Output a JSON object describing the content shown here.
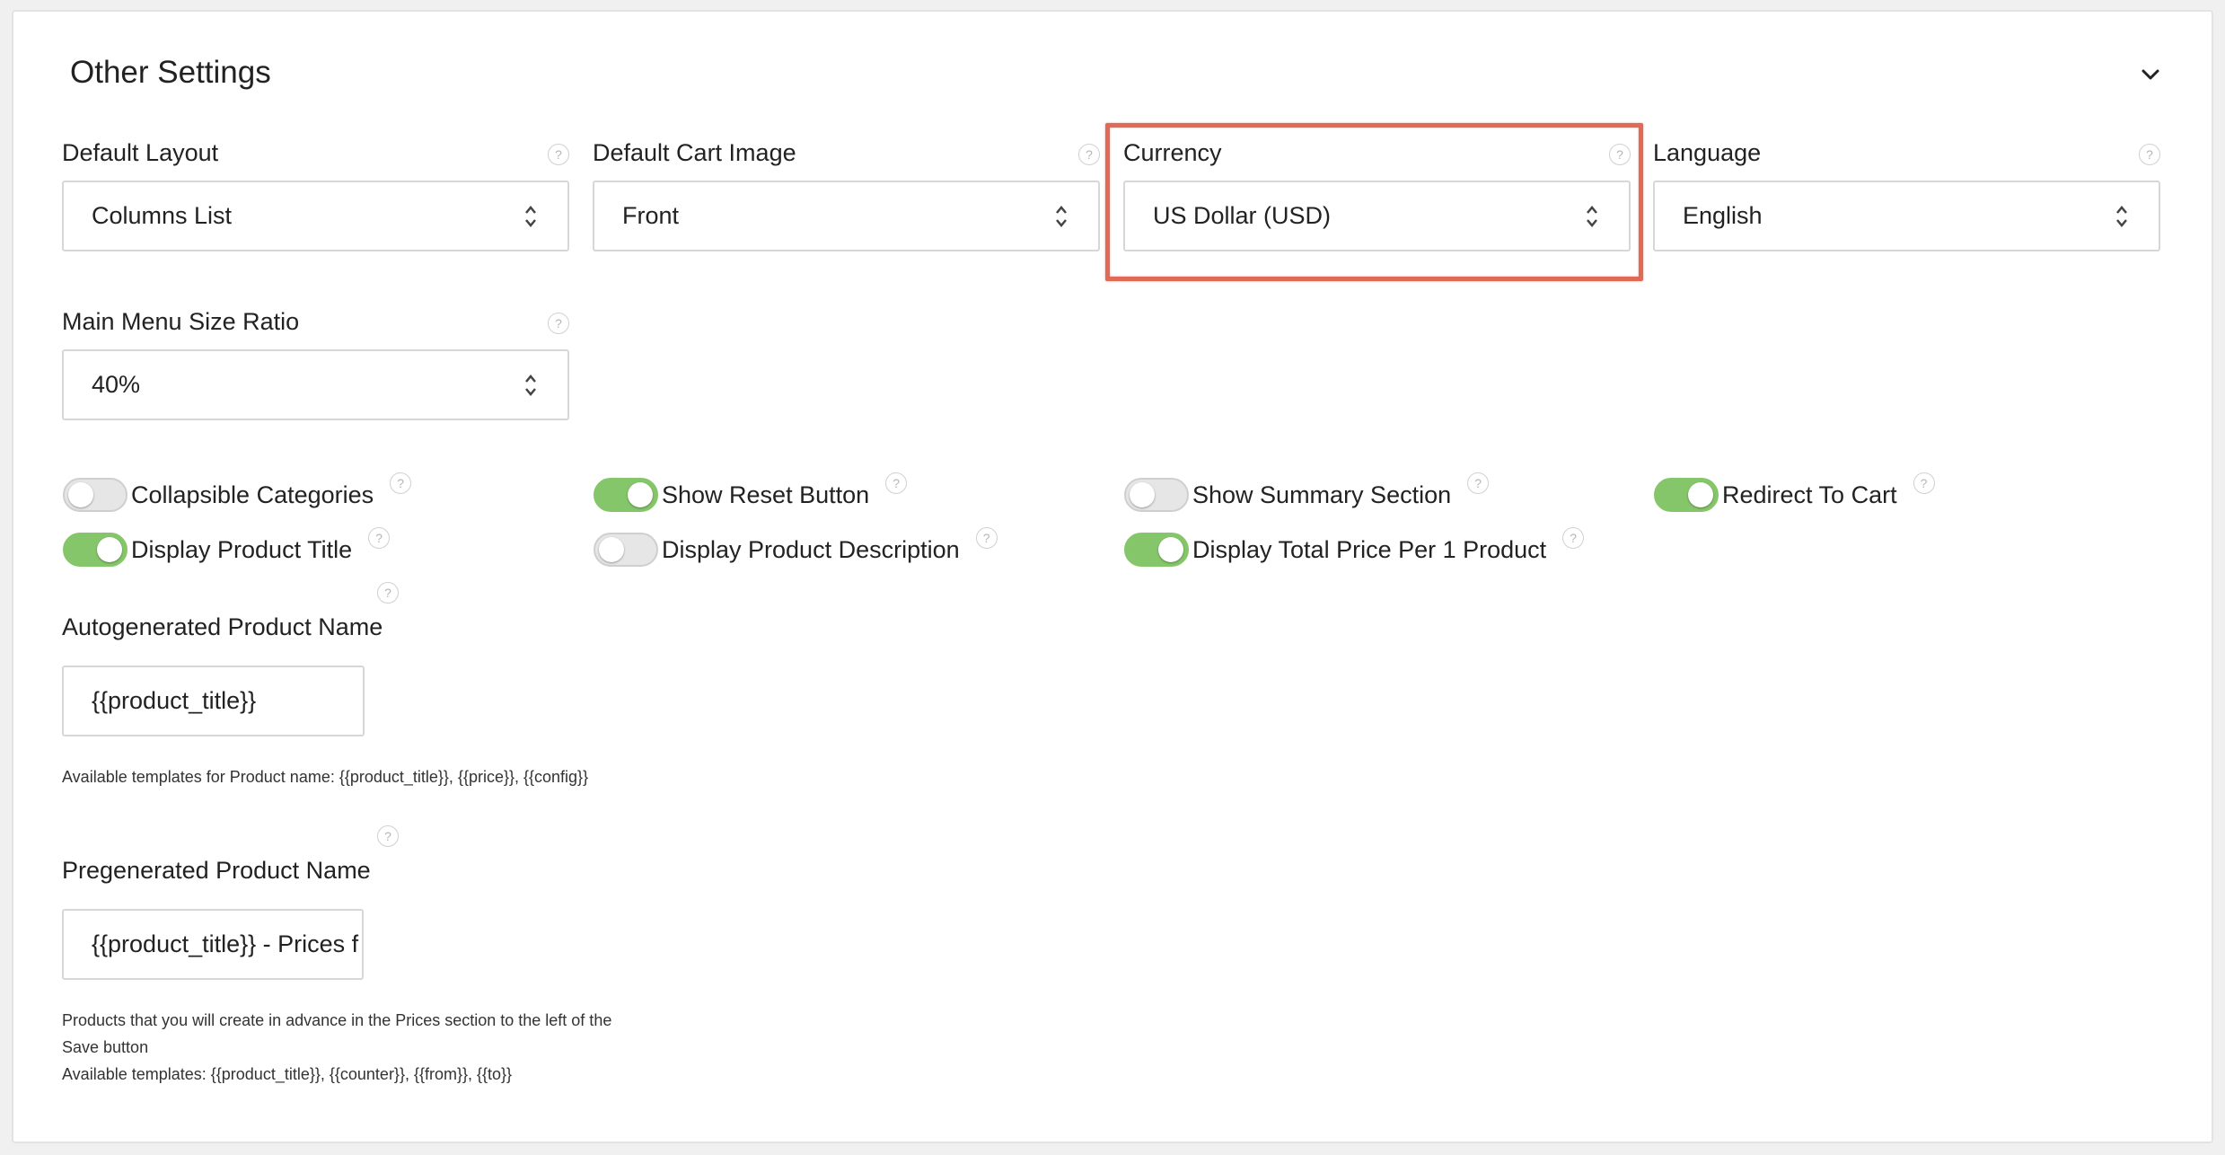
{
  "panel": {
    "title": "Other Settings",
    "collapse_icon": "chevron-down-icon"
  },
  "selects": {
    "default_layout": {
      "label": "Default Layout",
      "value": "Columns List"
    },
    "default_cart_image": {
      "label": "Default Cart Image",
      "value": "Front"
    },
    "currency": {
      "label": "Currency",
      "value": "US Dollar (USD)"
    },
    "language": {
      "label": "Language",
      "value": "English"
    },
    "main_menu_size_ratio": {
      "label": "Main Menu Size Ratio",
      "value": "40%"
    }
  },
  "help_glyph": "?",
  "toggles": {
    "collapsible_categories": {
      "label": "Collapsible Categories",
      "on": false
    },
    "show_reset_button": {
      "label": "Show Reset Button",
      "on": true
    },
    "show_summary_section": {
      "label": "Show Summary Section",
      "on": false
    },
    "redirect_to_cart": {
      "label": "Redirect To Cart",
      "on": true
    },
    "display_product_title": {
      "label": "Display Product Title",
      "on": true
    },
    "display_product_description": {
      "label": "Display Product Description",
      "on": false
    },
    "display_total_price": {
      "label": "Display Total Price Per 1 Product",
      "on": true
    }
  },
  "autogenerated": {
    "label": "Autogenerated Product Name",
    "value": "{{product_title}}",
    "hint": "Available templates for Product name: {{product_title}}, {{price}}, {{config}}"
  },
  "pregenerated": {
    "label": "Pregenerated Product Name",
    "value": "{{product_title}} - Prices f",
    "hint_line1": "Products that you will create in advance in the Prices section to the left of the",
    "hint_line2": "Save button",
    "hint_line3": "Available templates: {{product_title}}, {{counter}}, {{from}}, {{to}}"
  },
  "colors": {
    "toggle_on": "#86c66a",
    "toggle_off": "#e6e6e6",
    "highlight": "#e06a55"
  }
}
